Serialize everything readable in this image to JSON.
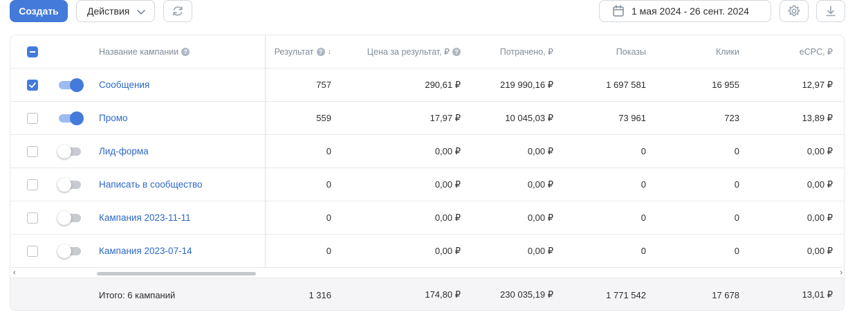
{
  "toolbar": {
    "create_label": "Создать",
    "actions_label": "Действия",
    "refresh_icon": "refresh-icon",
    "date_range": "1 мая 2024 - 26 сент. 2024",
    "settings_icon": "gear-icon",
    "download_icon": "download-icon"
  },
  "colors": {
    "primary": "#447bdb",
    "link": "#2d68c7",
    "header_text": "#818c99"
  },
  "table": {
    "headers": {
      "name": "Название кампании",
      "result": "Результат",
      "sort_indicator": "↓",
      "price": "Цена за результат, ₽",
      "spent": "Потрачено, ₽",
      "shows": "Показы",
      "clicks": "Клики",
      "ecpc": "eCPC, ₽"
    },
    "header_checkbox": "partial",
    "rows": [
      {
        "checked": true,
        "active": true,
        "name": "Сообщения",
        "result": "757",
        "price": "290,61 ₽",
        "spent": "219 990,16 ₽",
        "shows": "1 697 581",
        "clicks": "16 955",
        "ecpc": "12,97 ₽"
      },
      {
        "checked": false,
        "active": true,
        "name": "Промо",
        "result": "559",
        "price": "17,97 ₽",
        "spent": "10 045,03 ₽",
        "shows": "73 961",
        "clicks": "723",
        "ecpc": "13,89 ₽"
      },
      {
        "checked": false,
        "active": false,
        "name": "Лид-форма",
        "result": "0",
        "price": "0,00 ₽",
        "spent": "0,00 ₽",
        "shows": "0",
        "clicks": "0",
        "ecpc": "0,00 ₽"
      },
      {
        "checked": false,
        "active": false,
        "name": "Написать в сообщество",
        "result": "0",
        "price": "0,00 ₽",
        "spent": "0,00 ₽",
        "shows": "0",
        "clicks": "0",
        "ecpc": "0,00 ₽"
      },
      {
        "checked": false,
        "active": false,
        "name": "Кампания 2023-11-11",
        "result": "0",
        "price": "0,00 ₽",
        "spent": "0,00 ₽",
        "shows": "0",
        "clicks": "0",
        "ecpc": "0,00 ₽"
      },
      {
        "checked": false,
        "active": false,
        "name": "Кампания 2023-07-14",
        "result": "0",
        "price": "0,00 ₽",
        "spent": "0,00 ₽",
        "shows": "0",
        "clicks": "0",
        "ecpc": "0,00 ₽"
      }
    ],
    "totals": {
      "label": "Итого: 6 кампаний",
      "result": "1 316",
      "price": "174,80 ₽",
      "spent": "230 035,19 ₽",
      "shows": "1 771 542",
      "clicks": "17 678",
      "ecpc": "13,01 ₽"
    }
  }
}
